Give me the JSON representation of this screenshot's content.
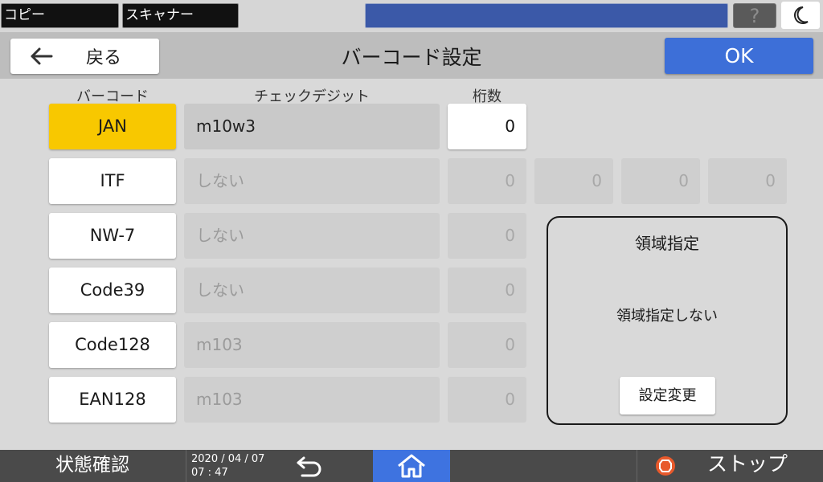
{
  "topbar": {
    "tabs": [
      {
        "label": "コピー"
      },
      {
        "label": "スキャナー"
      }
    ],
    "help_label": "?"
  },
  "header": {
    "back_label": "戻る",
    "title": "バーコード設定",
    "ok_label": "OK"
  },
  "columns": {
    "barcode": "バーコード",
    "checkdigit": "チェックデジット",
    "digits": "桁数"
  },
  "rows": [
    {
      "name": "JAN",
      "checkdigit": "m10w3",
      "digits": [
        "0"
      ]
    },
    {
      "name": "ITF",
      "checkdigit": "しない",
      "digits": [
        "0",
        "0",
        "0",
        "0"
      ]
    },
    {
      "name": "NW-7",
      "checkdigit": "しない",
      "digits": [
        "0"
      ]
    },
    {
      "name": "Code39",
      "checkdigit": "しない",
      "digits": [
        "0"
      ]
    },
    {
      "name": "Code128",
      "checkdigit": "m103",
      "digits": [
        "0"
      ]
    },
    {
      "name": "EAN128",
      "checkdigit": "m103",
      "digits": [
        "0"
      ]
    }
  ],
  "area": {
    "title": "領域指定",
    "value": "領域指定しない",
    "button_label": "設定変更"
  },
  "bottombar": {
    "status_label": "状態確認",
    "date": "2020 / 04 / 07",
    "time": "07 : 47",
    "stop_label": "ストップ"
  },
  "colors": {
    "selected": "#f8c800",
    "ok": "#3d6fd8",
    "home": "#3e73e0",
    "message_bar": "#3b59a8",
    "stop": "#e8592b"
  }
}
